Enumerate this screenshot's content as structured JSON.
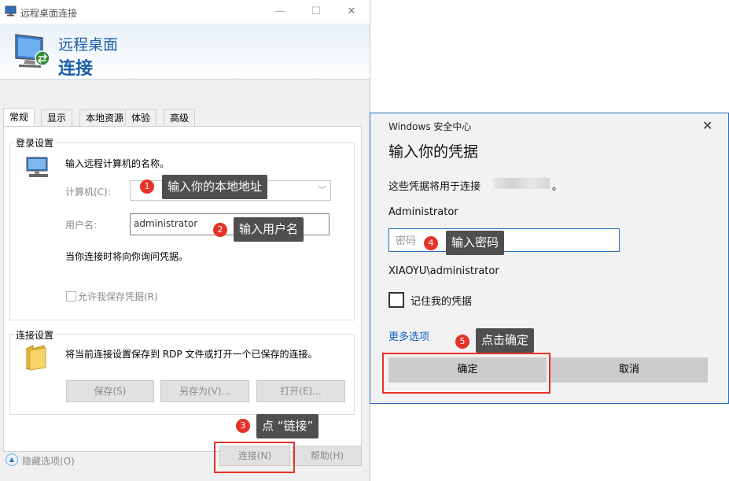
{
  "rdp": {
    "window_title": "远程桌面连接",
    "heading_line1": "远程桌面",
    "heading_line2": "连接",
    "tabs": [
      "常规",
      "显示",
      "本地资源",
      "体验",
      "高级"
    ],
    "login": {
      "group_label": "登录设置",
      "instruction": "输入远程计算机的名称。",
      "computer_label": "计算机(C):",
      "username_label": "用户名:",
      "username_value": "administrator",
      "note": "当你连接时将向你询问凭据。",
      "save_credentials_label": "允许我保存凭据(R)"
    },
    "connection": {
      "group_label": "连接设置",
      "description": "将当前连接设置保存到 RDP 文件或打开一个已保存的连接。",
      "save_button": "保存(S)",
      "save_as_button": "另存为(V)...",
      "open_button": "打开(E)..."
    },
    "footer": {
      "hide_options": "隐藏选项(O)",
      "connect_button": "连接(N)",
      "help_button": "帮助(H)"
    }
  },
  "security": {
    "app_name": "Windows 安全中心",
    "title": "输入你的凭据",
    "description": "这些凭据将用于连接",
    "description_end": "。",
    "username": "Administrator",
    "password_placeholder": "密码",
    "account": "XIAOYU\\administrator",
    "remember_label": "记住我的凭据",
    "more_options": "更多选项",
    "ok_button": "确定",
    "cancel_button": "取消"
  },
  "annotations": [
    {
      "number": "1",
      "text": "输入你的本地地址"
    },
    {
      "number": "2",
      "text": "输入用户名"
    },
    {
      "number": "3",
      "text": "点 “链接”"
    },
    {
      "number": "4",
      "text": "输入密码"
    },
    {
      "number": "5",
      "text": "点击确定"
    }
  ],
  "colors": {
    "accent_blue": "#1e5fa8",
    "annotation_red": "#e6332a",
    "tooltip_bg": "#4f4f4f",
    "link_blue": "#0b63c4"
  },
  "icons": {
    "title_icon": "remote-desktop-icon",
    "computer_icon": "computer-icon",
    "folder_icon": "folder-icon",
    "chevron": "chevron-down-icon",
    "close": "close-icon",
    "collapse": "chevron-up-icon"
  }
}
